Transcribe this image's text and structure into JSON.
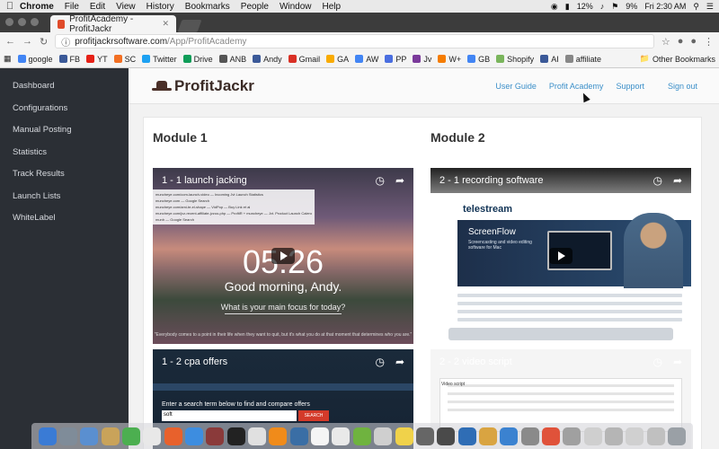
{
  "menubar": {
    "app": "Chrome",
    "items": [
      "File",
      "Edit",
      "View",
      "History",
      "Bookmarks",
      "People",
      "Window",
      "Help"
    ],
    "battery": "12%",
    "battery2": "9%",
    "time": "Fri 2:30 AM"
  },
  "browser": {
    "tab_title": "ProfitAcademy - ProfitJackr",
    "url_host": "profitjackrsoftware.com",
    "url_path": "/App/ProfitAcademy",
    "bookmarks": [
      {
        "label": "google",
        "color": "#4285f4"
      },
      {
        "label": "FB",
        "color": "#3b5998"
      },
      {
        "label": "YT",
        "color": "#e62117"
      },
      {
        "label": "SC",
        "color": "#f26f23"
      },
      {
        "label": "Twitter",
        "color": "#1da1f2"
      },
      {
        "label": "Drive",
        "color": "#0f9d58"
      },
      {
        "label": "ANB",
        "color": "#555555"
      },
      {
        "label": "Andy",
        "color": "#3b5998"
      },
      {
        "label": "Gmail",
        "color": "#d93025"
      },
      {
        "label": "GA",
        "color": "#f9ab00"
      },
      {
        "label": "AW",
        "color": "#4285f4"
      },
      {
        "label": "PP",
        "color": "#4a6ee0"
      },
      {
        "label": "Jv",
        "color": "#7a3a9a"
      },
      {
        "label": "W+",
        "color": "#f57c00"
      },
      {
        "label": "GB",
        "color": "#4285f4"
      },
      {
        "label": "Shopify",
        "color": "#7ab55c"
      },
      {
        "label": "AI",
        "color": "#3b5998"
      },
      {
        "label": "affiliate",
        "color": "#888888"
      }
    ],
    "other_bookmarks": "Other Bookmarks"
  },
  "sidebar": {
    "items": [
      "Dashboard",
      "Configurations",
      "Manual Posting",
      "Statistics",
      "Track Results",
      "Launch Lists",
      "WhiteLabel"
    ]
  },
  "header": {
    "logo": "ProfitJackr",
    "nav": [
      "User Guide",
      "Profit Academy",
      "Support",
      "Sign out"
    ]
  },
  "modules": [
    {
      "title": "Module 1",
      "videos": [
        {
          "title": "1 - 1 launch jacking",
          "clock": "05:26",
          "greeting": "Good morning, Andy.",
          "prompt": "What is your main focus for today?",
          "quote": "\"Everybody comes to a point in their life when they want to quit, but it's what you do at that moment that determines who you are.\"",
          "dropdown": [
            "muncheye.com/com-launch-video — Incoming Jvt Launch Statistics",
            "muncheye.com — Google Search",
            "muncheye.com/ami-te-el-shape — VidPop — Buy Link et al",
            "muncheye.com/jvz-recent-affiliate-jvzoo-php — ProfitR + muncheye — Jvt. Product Launch Calendar — WordPress",
            "munh — Google Search"
          ]
        },
        {
          "title": "1 - 2 cpa offers",
          "search_label": "Enter a search term below to find and compare offers",
          "search_value": "soft",
          "search_button": "SEARCH"
        }
      ]
    },
    {
      "title": "Module 2",
      "videos": [
        {
          "title": "2 - 1 recording software",
          "brand": "telestream",
          "product": "ScreenFlow",
          "product_desc": "Screencasting and video editing software for Mac"
        },
        {
          "title": "2 - 2 video script",
          "doc_name": "Video script"
        }
      ]
    }
  ]
}
